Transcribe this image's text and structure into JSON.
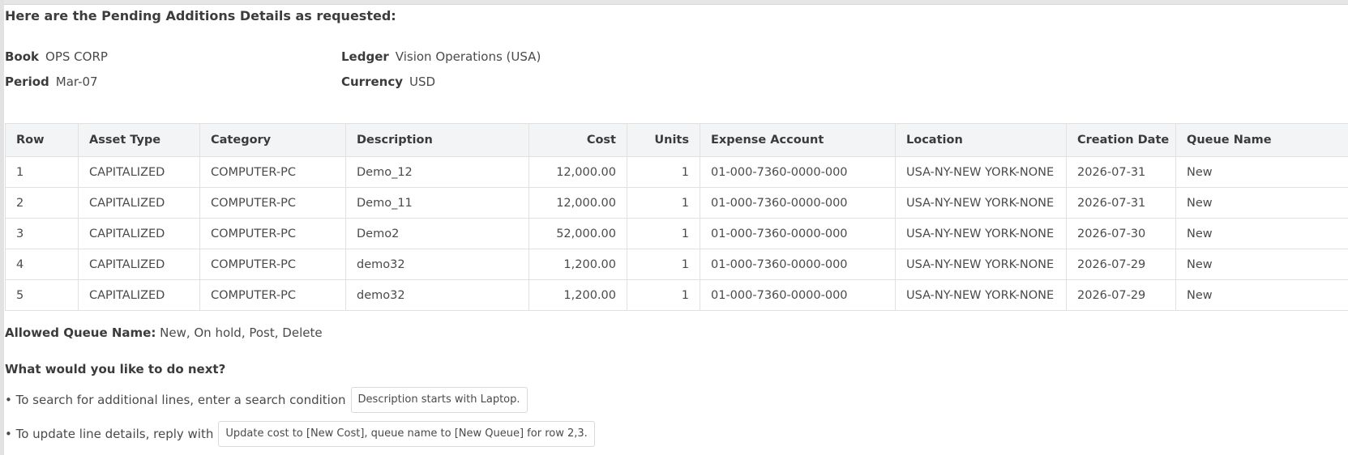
{
  "message": {
    "heading": "Here are the Pending Additions Details as requested:"
  },
  "meta": {
    "book_label": "Book",
    "book_value": "OPS CORP",
    "ledger_label": "Ledger",
    "ledger_value": "Vision Operations (USA)",
    "period_label": "Period",
    "period_value": "Mar-07",
    "currency_label": "Currency",
    "currency_value": "USD"
  },
  "table": {
    "headers": [
      "Row",
      "Asset Type",
      "Category",
      "Description",
      "Cost",
      "Units",
      "Expense Account",
      "Location",
      "Creation Date",
      "Queue Name"
    ],
    "rows": [
      [
        "1",
        "CAPITALIZED",
        "COMPUTER-PC",
        "Demo_12",
        "12,000.00",
        "1",
        "01-000-7360-0000-000",
        "USA-NY-NEW YORK-NONE",
        "2026-07-31",
        "New"
      ],
      [
        "2",
        "CAPITALIZED",
        "COMPUTER-PC",
        "Demo_11",
        "12,000.00",
        "1",
        "01-000-7360-0000-000",
        "USA-NY-NEW YORK-NONE",
        "2026-07-31",
        "New"
      ],
      [
        "3",
        "CAPITALIZED",
        "COMPUTER-PC",
        "Demo2",
        "52,000.00",
        "1",
        "01-000-7360-0000-000",
        "USA-NY-NEW YORK-NONE",
        "2026-07-30",
        "New"
      ],
      [
        "4",
        "CAPITALIZED",
        "COMPUTER-PC",
        "demo32",
        "1,200.00",
        "1",
        "01-000-7360-0000-000",
        "USA-NY-NEW YORK-NONE",
        "2026-07-29",
        "New"
      ],
      [
        "5",
        "CAPITALIZED",
        "COMPUTER-PC",
        "demo32",
        "1,200.00",
        "1",
        "01-000-7360-0000-000",
        "USA-NY-NEW YORK-NONE",
        "2026-07-29",
        "New"
      ]
    ]
  },
  "allowed": {
    "label": "Allowed Queue Name:",
    "values": "New, On hold, Post, Delete"
  },
  "next": {
    "question": "What would you like to do next?",
    "tips": [
      {
        "text": "• To search for additional lines, enter a search condition",
        "chip": "Description starts with Laptop."
      },
      {
        "text": "• To update line details, reply with",
        "chip": "Update cost to [New Cost], queue name to [New Queue] for row 2,3."
      }
    ]
  }
}
